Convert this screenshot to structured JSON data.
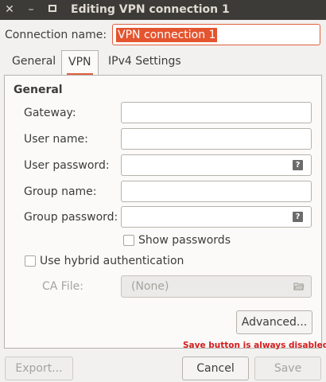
{
  "window": {
    "title": "Editing VPN connection 1"
  },
  "connection": {
    "label": "Connection name:",
    "value": "VPN connection 1"
  },
  "tabs": [
    {
      "label": "General"
    },
    {
      "label": "VPN"
    },
    {
      "label": "IPv4 Settings"
    }
  ],
  "active_tab": "VPN",
  "vpn": {
    "section_title": "General",
    "fields": {
      "gateway": {
        "label": "Gateway:",
        "value": ""
      },
      "user_name": {
        "label": "User name:",
        "value": ""
      },
      "user_password": {
        "label": "User password:",
        "value": ""
      },
      "group_name": {
        "label": "Group name:",
        "value": ""
      },
      "group_password": {
        "label": "Group password:",
        "value": ""
      }
    },
    "show_passwords": {
      "label": "Show passwords",
      "checked": false
    },
    "hybrid_auth": {
      "label": "Use hybrid authentication",
      "checked": false
    },
    "ca_file": {
      "label": "CA File:",
      "value": "(None)"
    },
    "advanced_label": "Advanced..."
  },
  "annotation": "Save button is always disabled",
  "buttons": {
    "export": "Export...",
    "cancel": "Cancel",
    "save": "Save"
  },
  "icons": {
    "password_hint": "?",
    "close": "✕",
    "minimize": "–",
    "maximize": "□"
  },
  "colors": {
    "accent": "#e05f3f",
    "selection": "#e4542e",
    "titlebar": "#3c3b37",
    "annotation": "#d41c1c"
  }
}
